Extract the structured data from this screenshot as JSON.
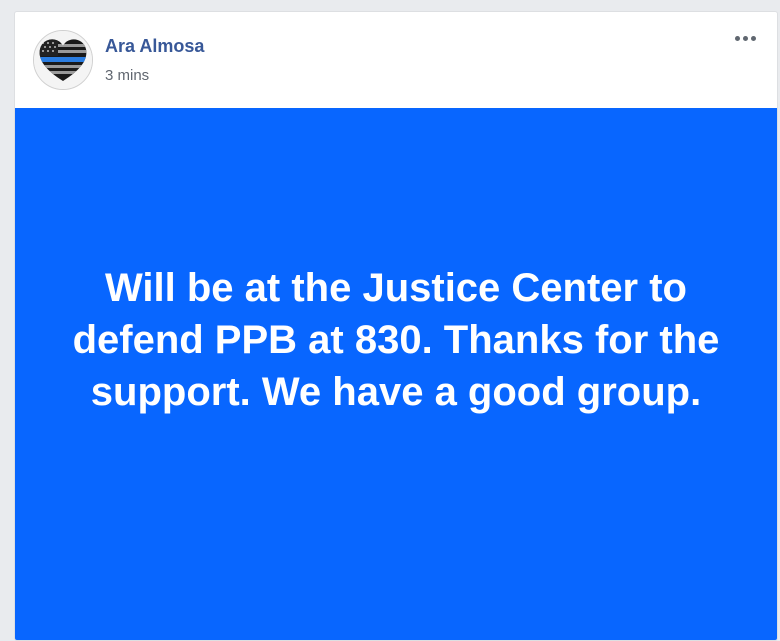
{
  "post": {
    "author": {
      "name": "Ara Almosa",
      "avatar_icon": "thin-blue-line-heart-flag-icon"
    },
    "timestamp": "3 mins",
    "more_icon": "ellipsis-icon",
    "status_text": "Will be at the Justice Center to defend PPB at 830. Thanks for the support. We have a good group.",
    "background_color": "#0866ff",
    "text_color": "#ffffff",
    "name_color": "#385898"
  }
}
